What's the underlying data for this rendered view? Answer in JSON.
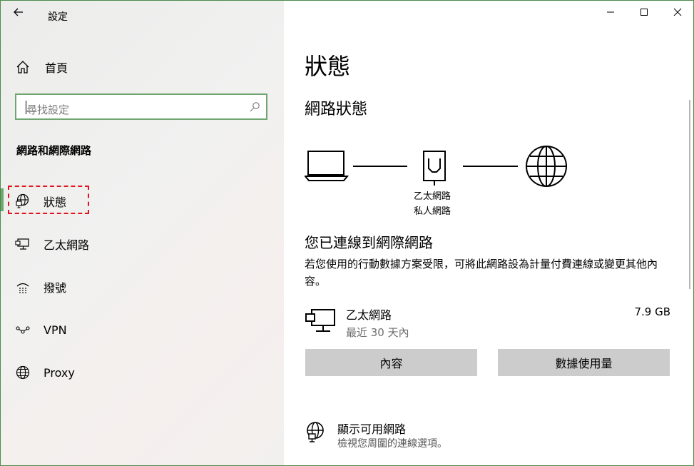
{
  "app": {
    "title": "設定"
  },
  "sidebar": {
    "home_label": "首頁",
    "search_placeholder": "尋找設定",
    "section_title": "網路和網際網路",
    "items": [
      {
        "label": "狀態",
        "icon": "globe-status-icon"
      },
      {
        "label": "乙太網路",
        "icon": "ethernet-icon"
      },
      {
        "label": "撥號",
        "icon": "dialup-icon"
      },
      {
        "label": "VPN",
        "icon": "vpn-icon"
      },
      {
        "label": "Proxy",
        "icon": "globe-icon"
      }
    ]
  },
  "main": {
    "title": "狀態",
    "subtitle": "網路狀態",
    "diagram": {
      "label_line1": "乙太網路",
      "label_line2": "私人網路"
    },
    "connected_title": "您已連線到網際網路",
    "connected_desc": "若您使用的行動數據方案受限，可將此網路設為計量付費連線或變更其他內容。",
    "ethernet": {
      "name": "乙太網路",
      "period": "最近 30 天內",
      "usage": "7.9 GB"
    },
    "buttons": {
      "properties": "內容",
      "data_usage": "數據使用量"
    },
    "available": {
      "title": "顯示可用網路",
      "desc": "檢視您周圍的連線選項。"
    }
  },
  "colors": {
    "accent": "#6fa56f",
    "highlight_dash": "#e0141e",
    "button_bg": "#cccccc"
  }
}
